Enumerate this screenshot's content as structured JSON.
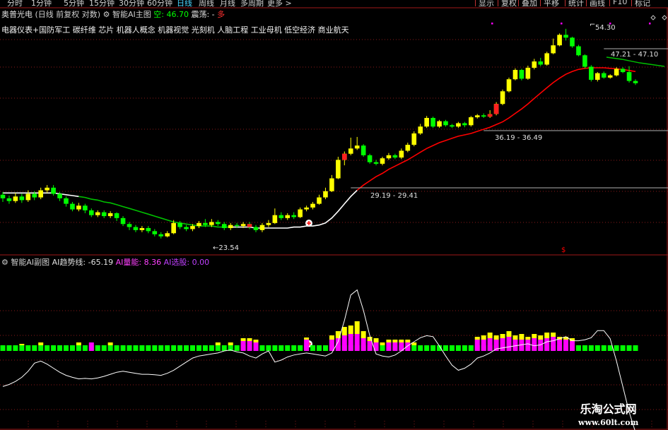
{
  "toolbar": {
    "timeframes": [
      "分时",
      "1分钟",
      "5分钟",
      "15分钟",
      "30分钟",
      "60分钟",
      "日线",
      "周线",
      "月线",
      "多周期",
      "更多 >"
    ],
    "active_timeframe": "日线",
    "buttons": [
      "显示",
      "复权",
      "叠加",
      "平移",
      "统计",
      "画线",
      "F10",
      "标记"
    ]
  },
  "main_header": {
    "stock": "奥普光电",
    "mode": "(日线 前复权 对数)",
    "indicator": "智能AI主图",
    "kong_label": "空:",
    "kong_value": "46.70",
    "zhendang": "震荡:",
    "zhendang_value": "-",
    "duo": "多",
    "concepts": "电器仪表+国防军工 碳纤维 芯片 机器人概念 机器视觉 光刻机 人脑工程 工业母机 低空经济 商业航天"
  },
  "annotations": {
    "high": "54.30",
    "low": "←23.54",
    "band1": "47.21 - 47.10",
    "band2": "36.19 - 36.49",
    "band3": "29.19 - 29.41",
    "dollar": "$"
  },
  "sub_header": {
    "name": "智能AI副图",
    "trend_label": "AI趋势线:",
    "trend_value": "-65.19",
    "energy_label": "AI量能:",
    "energy_value": "8.36",
    "pick_label": "AI选股:",
    "pick_value": "0.00"
  },
  "watermark": {
    "title": "乐淘公式网",
    "url": "www.60lt.com"
  },
  "colors": {
    "up": "#ffff00",
    "down": "#00ff00",
    "redline": "#ff0000",
    "greenline": "#00c000",
    "magenta": "#ff00ff"
  },
  "chart_data": {
    "type": "candlestick",
    "value_range": [
      22.5,
      56
    ],
    "candles": [
      [
        27.8,
        27.4,
        28.1,
        27.0
      ],
      [
        27.4,
        27.1,
        27.7,
        26.8
      ],
      [
        27.1,
        27.6,
        28.0,
        26.9
      ],
      [
        27.6,
        27.2,
        27.9,
        26.9
      ],
      [
        27.2,
        27.9,
        28.3,
        27.0
      ],
      [
        27.9,
        27.5,
        28.2,
        27.2
      ],
      [
        27.5,
        28.3,
        28.6,
        27.3
      ],
      [
        28.3,
        28.6,
        28.9,
        28.0
      ],
      [
        28.6,
        27.9,
        28.9,
        27.7
      ],
      [
        27.9,
        27.4,
        28.1,
        27.1
      ],
      [
        27.4,
        26.8,
        27.6,
        26.5
      ],
      [
        26.8,
        26.2,
        27.0,
        26.0
      ],
      [
        26.2,
        26.6,
        26.9,
        26.0
      ],
      [
        26.6,
        26.1,
        26.8,
        25.8
      ],
      [
        26.1,
        25.6,
        26.3,
        25.4
      ],
      [
        25.6,
        25.9,
        26.1,
        25.4
      ],
      [
        25.9,
        25.5,
        26.1,
        25.3
      ],
      [
        25.5,
        25.8,
        26.0,
        25.3
      ],
      [
        25.8,
        25.3,
        25.9,
        25.0
      ],
      [
        25.3,
        24.7,
        25.5,
        24.5
      ],
      [
        24.7,
        24.4,
        24.9,
        24.1
      ],
      [
        24.4,
        24.1,
        24.6,
        23.9
      ],
      [
        24.1,
        24.3,
        24.5,
        23.9
      ],
      [
        24.3,
        24.0,
        24.5,
        23.8
      ],
      [
        24.0,
        23.7,
        24.2,
        23.5
      ],
      [
        23.7,
        23.5,
        23.9,
        23.3
      ],
      [
        23.5,
        23.8,
        24.0,
        23.4
      ],
      [
        23.8,
        24.8,
        25.1,
        23.7
      ],
      [
        24.8,
        24.4,
        25.0,
        24.2
      ],
      [
        24.4,
        24.2,
        24.6,
        24.0
      ],
      [
        24.2,
        24.5,
        24.7,
        24.0
      ],
      [
        24.5,
        24.8,
        25.0,
        24.3
      ],
      [
        24.8,
        24.6,
        25.2,
        24.4
      ],
      [
        24.6,
        24.9,
        25.2,
        24.4
      ],
      [
        24.9,
        24.7,
        25.1,
        24.5
      ],
      [
        24.7,
        24.3,
        24.9,
        24.1
      ],
      [
        24.3,
        24.6,
        24.8,
        24.1
      ],
      [
        24.6,
        24.5,
        24.8,
        24.3
      ],
      [
        24.5,
        24.7,
        24.9,
        24.3
      ],
      [
        24.7,
        24.4,
        24.9,
        24.2
      ],
      [
        24.4,
        24.1,
        24.6,
        23.9
      ],
      [
        24.1,
        24.6,
        24.8,
        23.9
      ],
      [
        24.6,
        24.8,
        25.1,
        24.4
      ],
      [
        24.8,
        25.6,
        26.3,
        24.7
      ],
      [
        25.6,
        25.3,
        25.9,
        25.1
      ],
      [
        25.3,
        25.6,
        25.8,
        25.1
      ],
      [
        25.6,
        25.4,
        25.9,
        25.2
      ],
      [
        25.4,
        26.2,
        26.4,
        25.3
      ],
      [
        26.2,
        26.4,
        26.6,
        26.0
      ],
      [
        26.4,
        26.8,
        27.0,
        26.2
      ],
      [
        26.8,
        27.5,
        27.8,
        26.7
      ],
      [
        27.5,
        28.2,
        28.6,
        27.3
      ],
      [
        28.2,
        29.7,
        30.1,
        28.1
      ],
      [
        29.7,
        32.0,
        32.4,
        29.6
      ],
      [
        32.0,
        32.8,
        33.1,
        31.3
      ],
      [
        32.8,
        33.5,
        35.0,
        32.6
      ],
      [
        33.5,
        33.9,
        35.1,
        33.3
      ],
      [
        33.9,
        32.6,
        34.1,
        32.4
      ],
      [
        32.6,
        31.7,
        32.8,
        31.5
      ],
      [
        31.7,
        31.5,
        32.0,
        31.3
      ],
      [
        31.5,
        32.2,
        32.4,
        31.3
      ],
      [
        32.2,
        32.6,
        32.9,
        32.0
      ],
      [
        32.6,
        32.3,
        32.8,
        32.1
      ],
      [
        32.3,
        33.2,
        33.5,
        32.1
      ],
      [
        33.2,
        34.0,
        34.3,
        33.0
      ],
      [
        34.0,
        35.6,
        35.9,
        33.8
      ],
      [
        35.6,
        36.6,
        37.0,
        35.4
      ],
      [
        36.6,
        37.9,
        38.2,
        36.4
      ],
      [
        37.9,
        36.6,
        38.1,
        36.4
      ],
      [
        36.6,
        37.4,
        37.6,
        36.4
      ],
      [
        37.4,
        36.8,
        37.6,
        36.6
      ],
      [
        36.8,
        36.6,
        37.0,
        36.4
      ],
      [
        36.6,
        37.1,
        37.3,
        36.4
      ],
      [
        37.1,
        36.8,
        37.3,
        36.5
      ],
      [
        36.8,
        38.0,
        38.2,
        36.6
      ],
      [
        38.0,
        38.3,
        38.5,
        37.8
      ],
      [
        38.3,
        38.1,
        38.6,
        37.9
      ],
      [
        38.1,
        38.5,
        39.1,
        37.9
      ],
      [
        38.5,
        40.1,
        40.4,
        38.3
      ],
      [
        40.1,
        42.2,
        42.5,
        39.9
      ],
      [
        42.2,
        44.3,
        44.6,
        42.0
      ],
      [
        44.3,
        46.0,
        46.3,
        44.1
      ],
      [
        46.0,
        44.4,
        46.2,
        44.1
      ],
      [
        44.4,
        46.4,
        46.8,
        44.2
      ],
      [
        46.4,
        47.6,
        48.1,
        46.1
      ],
      [
        47.6,
        47.0,
        48.3,
        46.7
      ],
      [
        47.0,
        49.2,
        49.5,
        46.8
      ],
      [
        49.2,
        50.8,
        52.2,
        49.0
      ],
      [
        50.8,
        53.0,
        53.3,
        50.6
      ],
      [
        53.0,
        52.4,
        54.3,
        51.8
      ],
      [
        52.4,
        50.6,
        52.6,
        50.3
      ],
      [
        50.6,
        48.8,
        50.9,
        48.6
      ],
      [
        48.8,
        46.6,
        49.0,
        46.3
      ],
      [
        46.6,
        44.2,
        46.9,
        43.9
      ],
      [
        44.2,
        45.4,
        45.6,
        43.9
      ],
      [
        45.4,
        44.6,
        45.7,
        44.4
      ],
      [
        44.6,
        45.0,
        45.2,
        44.4
      ],
      [
        45.0,
        46.2,
        46.5,
        44.8
      ],
      [
        46.2,
        45.6,
        46.5,
        45.4
      ],
      [
        45.6,
        44.0,
        46.7,
        43.7
      ],
      [
        44.0,
        43.6,
        44.3,
        43.3
      ]
    ],
    "ma_values": [
      28.0,
      28.0,
      28.0,
      28.0,
      28.0,
      28.0,
      28.0,
      28.0,
      28.0,
      27.9,
      27.8,
      27.7,
      27.6,
      27.5,
      27.3,
      27.2,
      27.0,
      26.9,
      26.7,
      26.5,
      26.3,
      26.1,
      25.9,
      25.7,
      25.5,
      25.3,
      25.1,
      24.9,
      24.8,
      24.7,
      24.6,
      24.5,
      24.5,
      24.5,
      24.4,
      24.4,
      24.4,
      24.4,
      24.4,
      24.4,
      24.3,
      24.3,
      24.3,
      24.3,
      24.3,
      24.3,
      24.4,
      24.4,
      24.5,
      24.5,
      24.6,
      24.8,
      25.3,
      26.0,
      26.8,
      27.6,
      28.3,
      28.9,
      29.4,
      29.9,
      30.3,
      30.8,
      31.2,
      31.6,
      32.0,
      32.5,
      33.0,
      33.5,
      33.9,
      34.3,
      34.6,
      34.9,
      35.2,
      35.4,
      35.6,
      35.9,
      36.2,
      36.5,
      36.9,
      37.3,
      37.9,
      38.6,
      39.3,
      40.1,
      41.0,
      41.9,
      42.8,
      43.7,
      44.5,
      45.2,
      45.7,
      46.1,
      46.3,
      46.4,
      46.4,
      46.4,
      46.3,
      46.2,
      46.1,
      45.9,
      45.7
    ],
    "oscillator": [
      -70,
      -66,
      -60,
      -52,
      -40,
      -24,
      -20,
      -26,
      -34,
      -42,
      -48,
      -52,
      -55,
      -54,
      -55,
      -53,
      -50,
      -46,
      -42,
      -40,
      -42,
      -44,
      -46,
      -46,
      -47,
      -48,
      -44,
      -38,
      -30,
      -22,
      -14,
      -10,
      -8,
      -6,
      -4,
      0,
      2,
      -2,
      -4,
      -10,
      -14,
      -6,
      0,
      -22,
      -18,
      -12,
      -8,
      -6,
      -4,
      -6,
      -8,
      -10,
      -4,
      18,
      60,
      110,
      120,
      80,
      30,
      -6,
      -10,
      -12,
      -8,
      0,
      10,
      18,
      26,
      30,
      28,
      10,
      -10,
      -28,
      -38,
      -34,
      -26,
      -14,
      -10,
      -4,
      4,
      6,
      8,
      10,
      12,
      14,
      10,
      12,
      18,
      20,
      24,
      28,
      20,
      20,
      22,
      26,
      40,
      40,
      24,
      -20,
      -70,
      -120,
      -160
    ],
    "bars_right": [
      0,
      0,
      0,
      0,
      0,
      0,
      0,
      0,
      0,
      0,
      0,
      0,
      0,
      0,
      0,
      0,
      0,
      0,
      0,
      0,
      0,
      0,
      0,
      0,
      0,
      0,
      0,
      0,
      0,
      0,
      0,
      0,
      0,
      0,
      0,
      0,
      0,
      0,
      0,
      0,
      0,
      0,
      0,
      0,
      0,
      0,
      0,
      0,
      0,
      0,
      0,
      0,
      0,
      0,
      0,
      0,
      0,
      0,
      0,
      0,
      0,
      0,
      0,
      0,
      0,
      0,
      0,
      0,
      0,
      0,
      0,
      0,
      0,
      0,
      0,
      0,
      0,
      0,
      0,
      0,
      0,
      0,
      0,
      0,
      0,
      0,
      0,
      0,
      0,
      0,
      0,
      0,
      0,
      0,
      0,
      0,
      0,
      0,
      0,
      0,
      0
    ]
  }
}
